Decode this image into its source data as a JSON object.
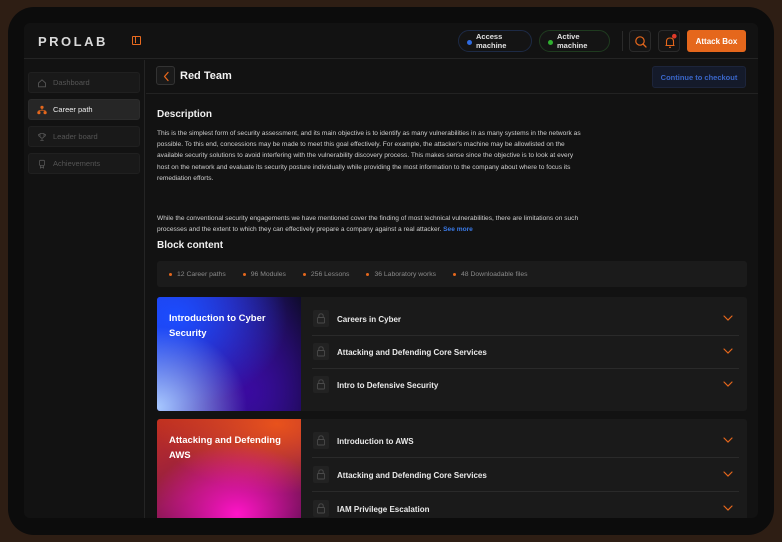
{
  "app": {
    "logo": "PROLAB"
  },
  "topbar": {
    "access_machine": "Access machine",
    "active_machine": "Active machine",
    "attack_box": "Attack Box"
  },
  "sidebar": {
    "items": [
      {
        "label": "Dashboard",
        "icon": "home-icon",
        "active": false
      },
      {
        "label": "Career path",
        "icon": "hierarchy-icon",
        "active": true
      },
      {
        "label": "Leader board",
        "icon": "trophy-icon",
        "active": false
      },
      {
        "label": "Achievements",
        "icon": "badge-icon",
        "active": false
      }
    ]
  },
  "header": {
    "title": "Red Team",
    "checkout": "Continue to checkout"
  },
  "description": {
    "heading": "Description",
    "paragraph1": "This is the simplest form of security assessment, and its main objective is to identify as many vulnerabilities in as many systems in the network as possible. To this end, concessions may be made to meet this goal effectively. For example, the attacker's machine may be allowlisted on the available security solutions to avoid interfering with the vulnerability discovery process. This makes sense since the objective is to look at every host on the network and evaluate its security posture individually while providing the most information to the company about where to focus its remediation efforts.",
    "paragraph2": "While the conventional security engagements we have mentioned cover the finding of most technical vulnerabilities, there are limitations on such processes and the extent to which they can effectively prepare a company against a real attacker.",
    "see_more": "See more"
  },
  "block_content": {
    "heading": "Block content",
    "stats": [
      "12 Career paths",
      "96 Modules",
      "256 Lessons",
      "36 Laboratory works",
      "48 Downloadable files"
    ],
    "blocks": [
      {
        "title": "Introduction to Cyber Security",
        "lessons": [
          "Careers in Cyber",
          "Attacking and Defending Core Services",
          "Intro to Defensive Security"
        ]
      },
      {
        "title": "Attacking and Defending AWS",
        "lessons": [
          "Introduction to AWS",
          "Attacking and Defending Core Services",
          "IAM Privilege Escalation"
        ]
      }
    ]
  },
  "colors": {
    "accent": "#e5671c",
    "link": "#3a7ae8",
    "access_dot": "#2f6be0",
    "active_dot": "#30b030"
  }
}
